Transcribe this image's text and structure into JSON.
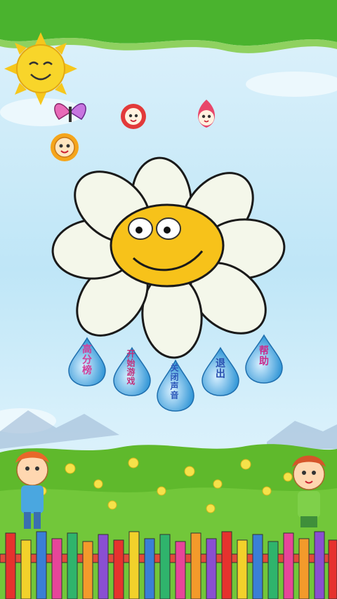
{
  "menu": {
    "buttons": [
      {
        "label": "高分榜",
        "color": "#d23f9a"
      },
      {
        "label": "开始游戏",
        "color": "#c2307b"
      },
      {
        "label": "关闭声音",
        "color": "#2b57b9"
      },
      {
        "label": "退出",
        "color": "#2a4fb0"
      },
      {
        "label": "帮助",
        "color": "#c82d8d"
      }
    ]
  },
  "colors": {
    "sky": "#bfe6f7",
    "grass": "#5fb92c",
    "petal": "#f4f7ea",
    "face": "#f7c21a",
    "drop": "#2f95d6"
  }
}
